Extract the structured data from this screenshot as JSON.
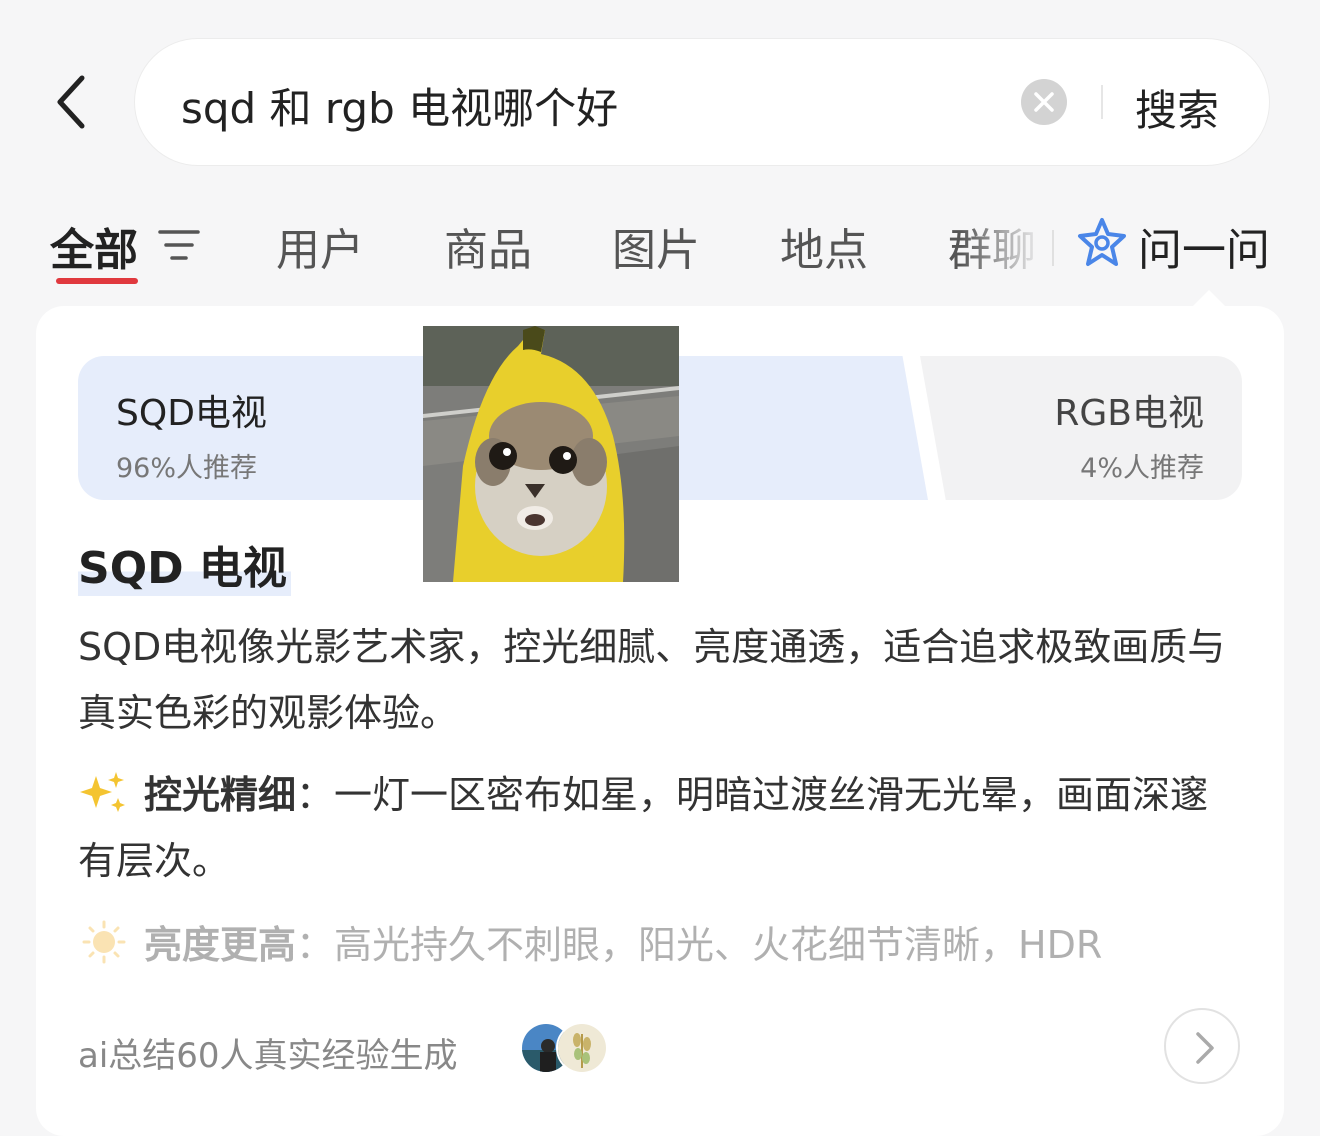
{
  "header": {
    "search": {
      "value": "sqd 和 rgb 电视哪个好",
      "button_label": "搜索"
    }
  },
  "tabs": [
    {
      "label": "全部",
      "active": true
    },
    {
      "label": "用户"
    },
    {
      "label": "商品"
    },
    {
      "label": "图片"
    },
    {
      "label": "地点"
    },
    {
      "label": "群聊"
    }
  ],
  "ask": {
    "label": "问一问"
  },
  "card": {
    "options": {
      "left": {
        "name": "SQD电视",
        "pct": "96%人推荐"
      },
      "right": {
        "name": "RGB电视",
        "pct": "4%人推荐"
      }
    },
    "heading": "SQD 电视",
    "paragraph": "SQD电视像光影艺术家，控光细腻、亮度通透，适合追求极致画质与真实色彩的观影体验。",
    "point1": {
      "title": "控光精细",
      "text": "：一灯一区密布如星，明暗过渡丝滑无光晕，画面深邃有层次。"
    },
    "point2": {
      "title": "亮度更高",
      "text": "：高光持久不刺眼，阳光、火花细节清晰，HDR"
    },
    "footer": "ai总结60人真实经验生成"
  },
  "colors": {
    "accent": "#e0393e",
    "ask_icon": "#4a86e8",
    "option_bg": "#e6edfb"
  }
}
